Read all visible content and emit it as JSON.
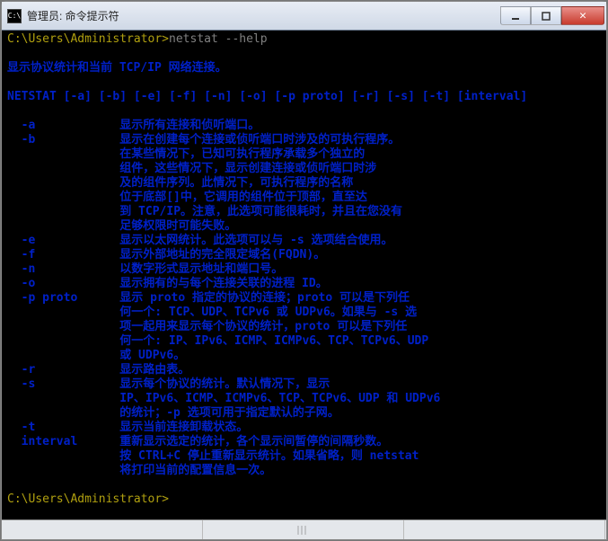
{
  "window": {
    "title": "管理员: 命令提示符",
    "icon_char": "C:\\"
  },
  "prompt1": {
    "path": "C:\\Users\\Administrator>",
    "command": "netstat --help"
  },
  "intro": "显示协议统计和当前 TCP/IP 网络连接。",
  "usage": "NETSTAT [-a] [-b] [-e] [-f] [-n] [-o] [-p proto] [-r] [-s] [-t] [interval]",
  "opts": {
    "a": "显示所有连接和侦听端口。",
    "b1": "显示在创建每个连接或侦听端口时涉及的可执行程序。",
    "b2": "在某些情况下，已知可执行程序承载多个独立的",
    "b3": "组件，这些情况下，显示创建连接或侦听端口时涉",
    "b4": "及的组件序列。此情况下，可执行程序的名称",
    "b5": "位于底部[]中，它调用的组件位于顶部，直至达",
    "b6": "到 TCP/IP。注意，此选项可能很耗时，并且在您没有",
    "b7": "足够权限时可能失败。",
    "e": "显示以太网统计。此选项可以与 -s 选项结合使用。",
    "f": "显示外部地址的完全限定域名(FQDN)。",
    "n": "以数字形式显示地址和端口号。",
    "o": "显示拥有的与每个连接关联的进程 ID。",
    "p1": "显示 proto 指定的协议的连接；proto 可以是下列任",
    "p2": "何一个: TCP、UDP、TCPv6 或 UDPv6。如果与 -s 选",
    "p3": "项一起用来显示每个协议的统计，proto 可以是下列任",
    "p4": "何一个: IP、IPv6、ICMP、ICMPv6、TCP、TCPv6、UDP",
    "p5": "或 UDPv6。",
    "r": "显示路由表。",
    "s1": "显示每个协议的统计。默认情况下，显示",
    "s2": "IP、IPv6、ICMP、ICMPv6、TCP、TCPv6、UDP 和 UDPv6",
    "s3": "的统计；-p 选项可用于指定默认的子网。",
    "t": "显示当前连接卸载状态。",
    "i1": "重新显示选定的统计，各个显示间暂停的间隔秒数。",
    "i2": "按 CTRL+C 停止重新显示统计。如果省略，则 netstat",
    "i3": "将打印当前的配置信息一次。"
  },
  "labels": {
    "a": "-a",
    "b": "-b",
    "e": "-e",
    "f": "-f",
    "n": "-n",
    "o": "-o",
    "p": "-p proto",
    "r": "-r",
    "s": "-s",
    "t": "-t",
    "interval": "interval"
  },
  "prompt2": "C:\\Users\\Administrator>"
}
